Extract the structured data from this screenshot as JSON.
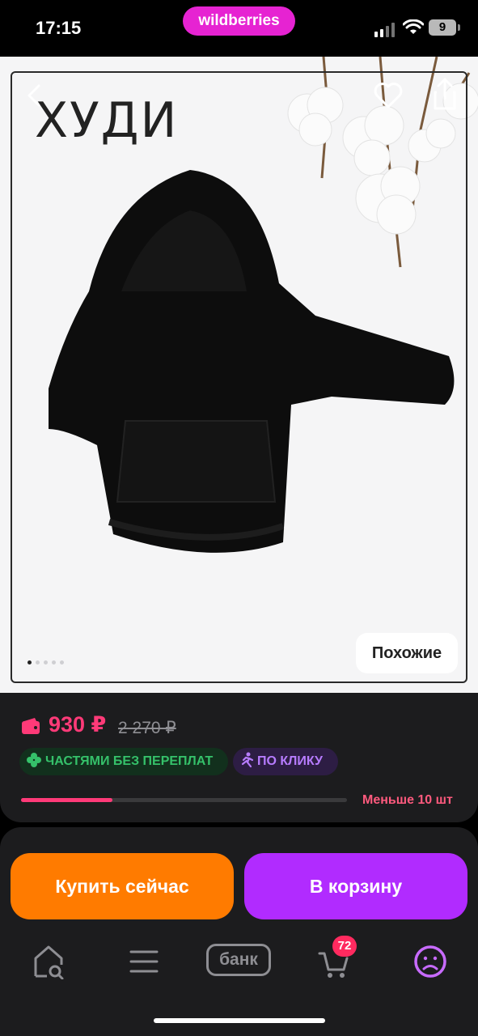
{
  "status_bar": {
    "time": "17:15",
    "app_pill": "wildberries",
    "battery": "9",
    "icons": [
      "signal-icon",
      "wifi-icon",
      "battery-icon"
    ]
  },
  "product": {
    "image_title": "ХУДИ",
    "image_index": 1,
    "image_count": 5,
    "similar_label": "Похожие",
    "icons": [
      "back-icon",
      "heart-icon",
      "share-icon"
    ]
  },
  "price": {
    "current": "930 ₽",
    "old": "2 270 ₽",
    "badge_split": "ЧАСТЯМИ БЕЗ ПЕРЕПЛАТ",
    "badge_click": "ПО КЛИКУ",
    "stock_label": "Меньше 10 шт",
    "stock_level": 0.28
  },
  "actions": {
    "buy_now": "Купить сейчас",
    "add_to_cart": "В корзину"
  },
  "nav": {
    "bank_label": "банк",
    "cart_count": "72",
    "items": [
      "home-search-icon",
      "catalog-icon",
      "bank-icon",
      "cart-icon",
      "profile-icon"
    ]
  },
  "colors": {
    "accent_pink": "#ff3a78",
    "buy_orange": "#ff7b00",
    "cart_purple": "#b12bff",
    "brand_magenta": "#e623d2"
  }
}
